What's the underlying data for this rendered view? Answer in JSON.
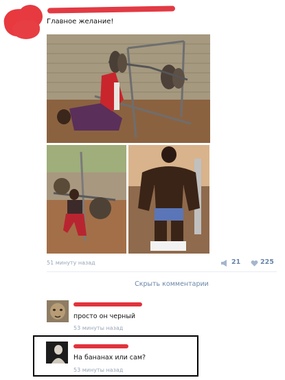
{
  "post": {
    "text": "Главное желание!",
    "time": "51 минуту назад",
    "shares": "21",
    "likes": "225",
    "icons": {
      "share": "megaphone-icon",
      "like": "heart-icon"
    }
  },
  "hide_comments_label": "Скрыть комментарии",
  "comments": [
    {
      "text": "просто он черный",
      "time": "53 минуты назад"
    },
    {
      "text": "На бананах или сам?",
      "time": "53 минуты назад"
    }
  ],
  "colors": {
    "link": "#6a86a8",
    "meta": "#9aa7b8",
    "redaction": "#e23a44"
  }
}
